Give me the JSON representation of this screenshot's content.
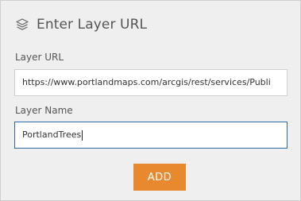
{
  "header": {
    "icon": "layers-icon",
    "title": "Enter Layer URL"
  },
  "form": {
    "url_label": "Layer URL",
    "url_value": "https://www.portlandmaps.com/arcgis/rest/services/Publi",
    "name_label": "Layer Name",
    "name_value": "PortlandTrees",
    "add_label": "ADD"
  },
  "colors": {
    "panel_bg": "#efefef",
    "accent_button": "#e8892f",
    "focus_border": "#2c6aa0"
  }
}
